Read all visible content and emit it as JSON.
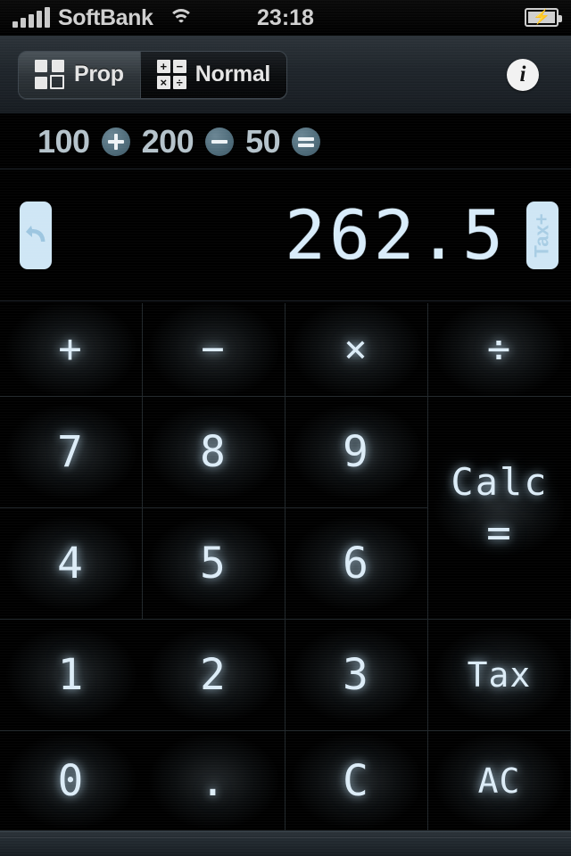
{
  "statusbar": {
    "carrier": "SoftBank",
    "time": "23:18",
    "signal_icon": "signal-bars-icon",
    "wifi_icon": "wifi-icon",
    "battery_icon": "battery-charging-icon",
    "battery_bolt": "⚡"
  },
  "toolbar": {
    "segments": [
      {
        "label": "Prop",
        "icon": "blocks-icon",
        "selected": true
      },
      {
        "label": "Normal",
        "icon": "operators-icon",
        "selected": false
      }
    ],
    "operator_tiles": [
      "+",
      "−",
      "×",
      "÷"
    ],
    "info_label": "i",
    "info_icon": "info-icon"
  },
  "expression": {
    "tokens": [
      {
        "type": "number",
        "text": "100"
      },
      {
        "type": "operator",
        "text": "+",
        "icon": "plus-chip-icon"
      },
      {
        "type": "number",
        "text": "200"
      },
      {
        "type": "operator",
        "text": "−",
        "icon": "minus-chip-icon"
      },
      {
        "type": "number",
        "text": "50"
      },
      {
        "type": "operator",
        "text": "=",
        "icon": "equals-chip-icon"
      }
    ]
  },
  "display": {
    "value": "262.5",
    "undo_icon": "undo-arrow-icon",
    "tax_label": "Tax+",
    "tax_icon": "tax-plus-icon"
  },
  "keypad": {
    "keys": [
      {
        "label": "+",
        "name": "key-plus",
        "kind": "op"
      },
      {
        "label": "−",
        "name": "key-minus",
        "kind": "op"
      },
      {
        "label": "×",
        "name": "key-multiply",
        "kind": "op"
      },
      {
        "label": "÷",
        "name": "key-divide",
        "kind": "op"
      },
      {
        "label": "7",
        "name": "key-7",
        "kind": "digit"
      },
      {
        "label": "8",
        "name": "key-8",
        "kind": "digit"
      },
      {
        "label": "9",
        "name": "key-9",
        "kind": "digit"
      },
      {
        "label": "Calc",
        "sub": "=",
        "name": "key-calc-equals",
        "kind": "tall"
      },
      {
        "label": "4",
        "name": "key-4",
        "kind": "digit"
      },
      {
        "label": "5",
        "name": "key-5",
        "kind": "digit"
      },
      {
        "label": "6",
        "name": "key-6",
        "kind": "digit"
      },
      {
        "label": "1",
        "name": "key-1",
        "kind": "digit"
      },
      {
        "label": "2",
        "name": "key-2",
        "kind": "digit"
      },
      {
        "label": "3",
        "name": "key-3",
        "kind": "digit"
      },
      {
        "label": "Tax",
        "name": "key-tax",
        "kind": "word"
      },
      {
        "label": "0",
        "name": "key-0",
        "kind": "digit"
      },
      {
        "label": ".",
        "name": "key-decimal",
        "kind": "dot"
      },
      {
        "label": "C",
        "name": "key-clear",
        "kind": "word"
      },
      {
        "label": "AC",
        "name": "key-all-clear",
        "kind": "word"
      }
    ]
  },
  "colors": {
    "lcd": "#d8ecfa",
    "accent_chip": "#4e6b79",
    "toolbar": "#232a30",
    "key_text": "#dcecf7"
  }
}
